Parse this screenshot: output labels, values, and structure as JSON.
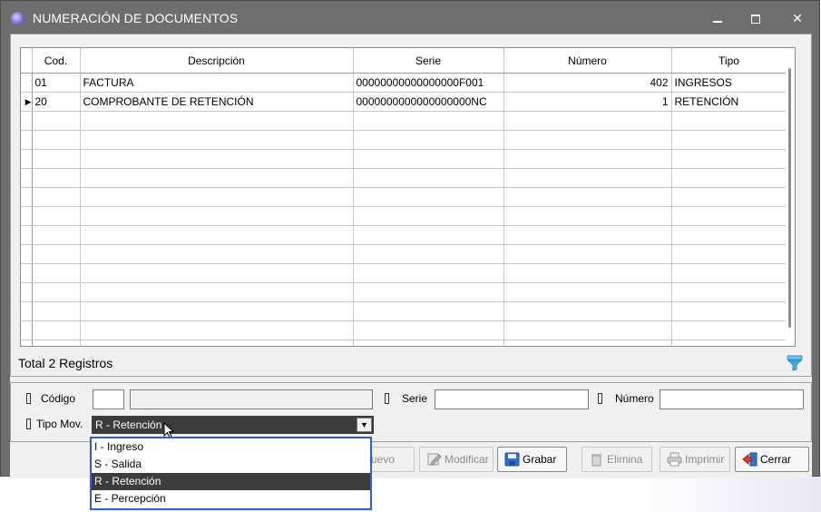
{
  "window": {
    "title": "NUMERACIÓN DE DOCUMENTOS"
  },
  "grid": {
    "columns": [
      "Cod.",
      "Descripción",
      "Serie",
      "Número",
      "Tipo"
    ],
    "rows": [
      {
        "cod": "01",
        "descripcion": "FACTURA",
        "serie": "00000000000000000F001",
        "numero": "402",
        "tipo": "INGRESOS"
      },
      {
        "cod": "20",
        "descripcion": "COMPROBANTE DE RETENCIÓN",
        "serie": "0000000000000000000NC",
        "numero": "1",
        "tipo": "RETENCIÓN"
      }
    ],
    "current_row_marker": "▶",
    "total": "Total 2 Registros"
  },
  "form": {
    "codigo_label": "Código",
    "codigo_value": "",
    "codigo_desc_value": "",
    "serie_label": "Serie",
    "serie_value": "",
    "numero_label": "Número",
    "numero_value": "",
    "tipo_mov_label": "Tipo Mov.",
    "tipo_mov_value": "R - Retención",
    "tipo_mov_options": [
      "I - Ingreso",
      "S - Salida",
      "R - Retención",
      "E - Percepción"
    ]
  },
  "toolbar": {
    "nuevo": "uevo",
    "modificar": "Modificar",
    "grabar": "Grabar",
    "elimina": "Elimina",
    "imprimir": "Imprimir",
    "cerrar": "Cerrar"
  },
  "colors": {
    "title_bar": "#6e6e6e",
    "selection": "#3c3c3c",
    "dropdown_border": "#2f5ae6",
    "filter_icon": "#3fa9e0"
  }
}
